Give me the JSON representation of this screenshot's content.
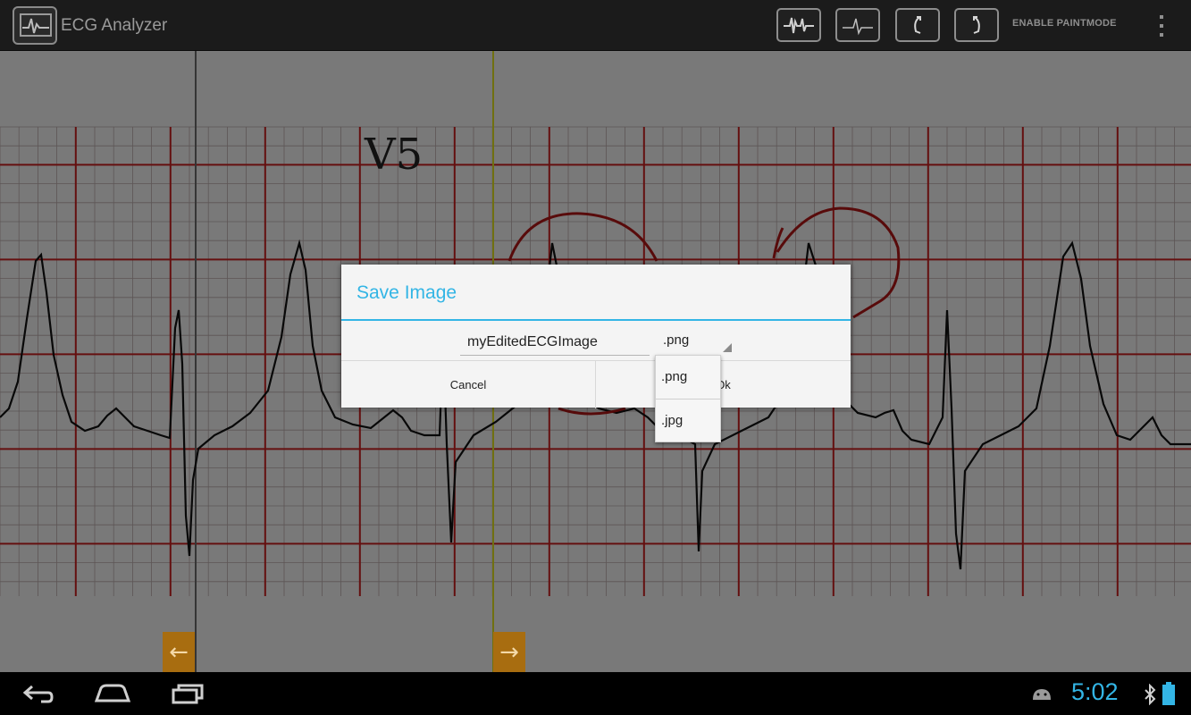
{
  "app": {
    "title": "ECG Analyzer"
  },
  "toolbar": {
    "paintmode_label": "ENABLE PAINTMODE",
    "icons": [
      "ecg-waveform-icon",
      "ecg-beat-icon",
      "undo-icon",
      "redo-icon",
      "overflow-menu-icon"
    ]
  },
  "ecg": {
    "lead_label": "V5"
  },
  "dialog": {
    "title": "Save Image",
    "filename_value": "myEditedECGImage",
    "extension_selected": ".png",
    "cancel_label": "Cancel",
    "ok_label": "Ok",
    "extension_options": [
      ".png",
      ".jpg"
    ]
  },
  "navbar": {
    "time": "5:02"
  },
  "colors": {
    "accent": "#33b5e5",
    "grid": "#c81f1f",
    "nav_arrow": "#a86d10"
  }
}
